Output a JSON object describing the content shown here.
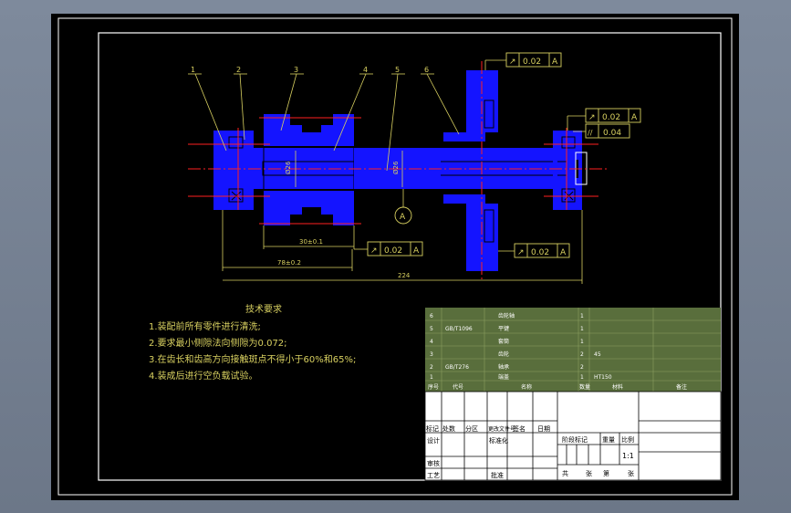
{
  "colors": {
    "background": "#000000",
    "part_fill": "#1414ff",
    "centerline": "#ff2020",
    "annotation": "#d8d060",
    "frame": "#ffffff",
    "bom_fill": "#596e3c"
  },
  "balloons": [
    "1",
    "2",
    "3",
    "4",
    "5",
    "6"
  ],
  "dimensions": {
    "d1": "30±0.1",
    "d2": "78±0.2",
    "d3": "224",
    "dia1": "Ø26",
    "dia2": "Ø26"
  },
  "tolerances": [
    {
      "symbol": "↗",
      "value": "0.02",
      "datum": "A"
    },
    {
      "symbol": "↗",
      "value": "0.02",
      "datum": "A"
    },
    {
      "symbol": "//",
      "value": "0.04",
      "datum": ""
    },
    {
      "symbol": "↗",
      "value": "0.02",
      "datum": "A"
    },
    {
      "symbol": "↗",
      "value": "0.02",
      "datum": "A"
    }
  ],
  "datum_label": "A",
  "notes": {
    "title": "技术要求",
    "lines": [
      "1.装配前所有零件进行清洗;",
      "2.要求最小侧隙法向侧隙为0.072;",
      "3.在齿长和齿高方向接触斑点不得小于60%和65%;",
      "4.装成后进行空负载试验。"
    ]
  },
  "bom": {
    "rows": [
      {
        "no": "6",
        "code": "",
        "name": "齿轮轴",
        "qty": "1",
        "material": "",
        "note": ""
      },
      {
        "no": "5",
        "code": "GB/T1096",
        "name": "平键",
        "qty": "1",
        "material": "",
        "note": ""
      },
      {
        "no": "4",
        "code": "",
        "name": "套筒",
        "qty": "1",
        "material": "",
        "note": ""
      },
      {
        "no": "3",
        "code": "",
        "name": "齿轮",
        "qty": "2",
        "material": "45",
        "note": ""
      },
      {
        "no": "2",
        "code": "GB/T276",
        "name": "轴承",
        "qty": "2",
        "material": "",
        "note": ""
      },
      {
        "no": "1",
        "code": "",
        "name": "端盖",
        "qty": "1",
        "material": "HT150",
        "note": ""
      }
    ],
    "headers": [
      "序号",
      "代号",
      "名称",
      "数量",
      "材料",
      "备注"
    ]
  },
  "title_block": {
    "rev_headers": [
      "标记",
      "处数",
      "分区",
      "更改文件号",
      "签名",
      "日期"
    ],
    "design": "设计",
    "standardize": "标准化",
    "review": "审核",
    "process": "工艺",
    "approve": "批准",
    "stage": "阶段标记",
    "weight": "重量",
    "scale": "比例",
    "scale_value": "1:1",
    "sheet_total": "共",
    "sheet_unit": "张",
    "sheet_no": "第",
    "sheet_unit2": "张"
  }
}
